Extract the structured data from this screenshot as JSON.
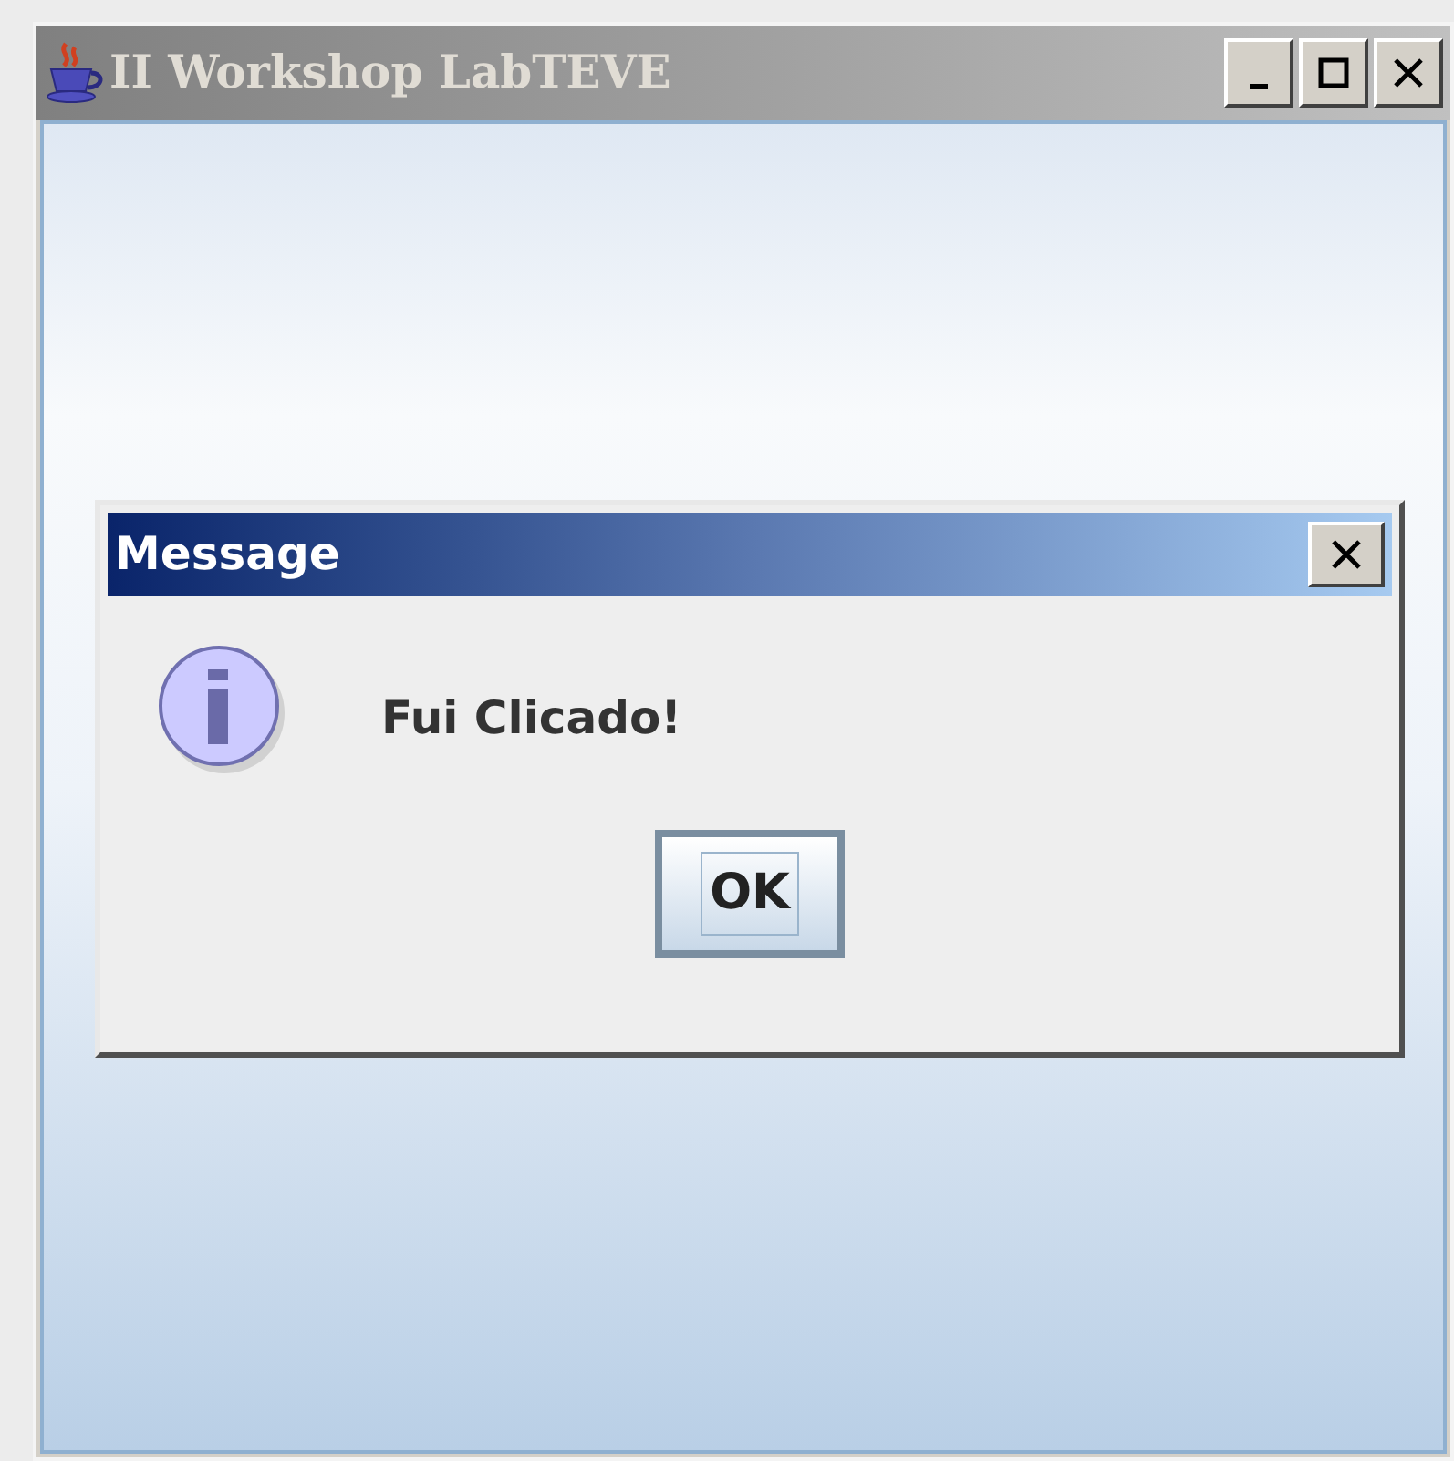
{
  "window": {
    "title": "II Workshop LabTEVE"
  },
  "dialog": {
    "title": "Message",
    "message": "Fui Clicado!",
    "buttons": [
      {
        "label": "OK",
        "focused": true
      }
    ]
  }
}
